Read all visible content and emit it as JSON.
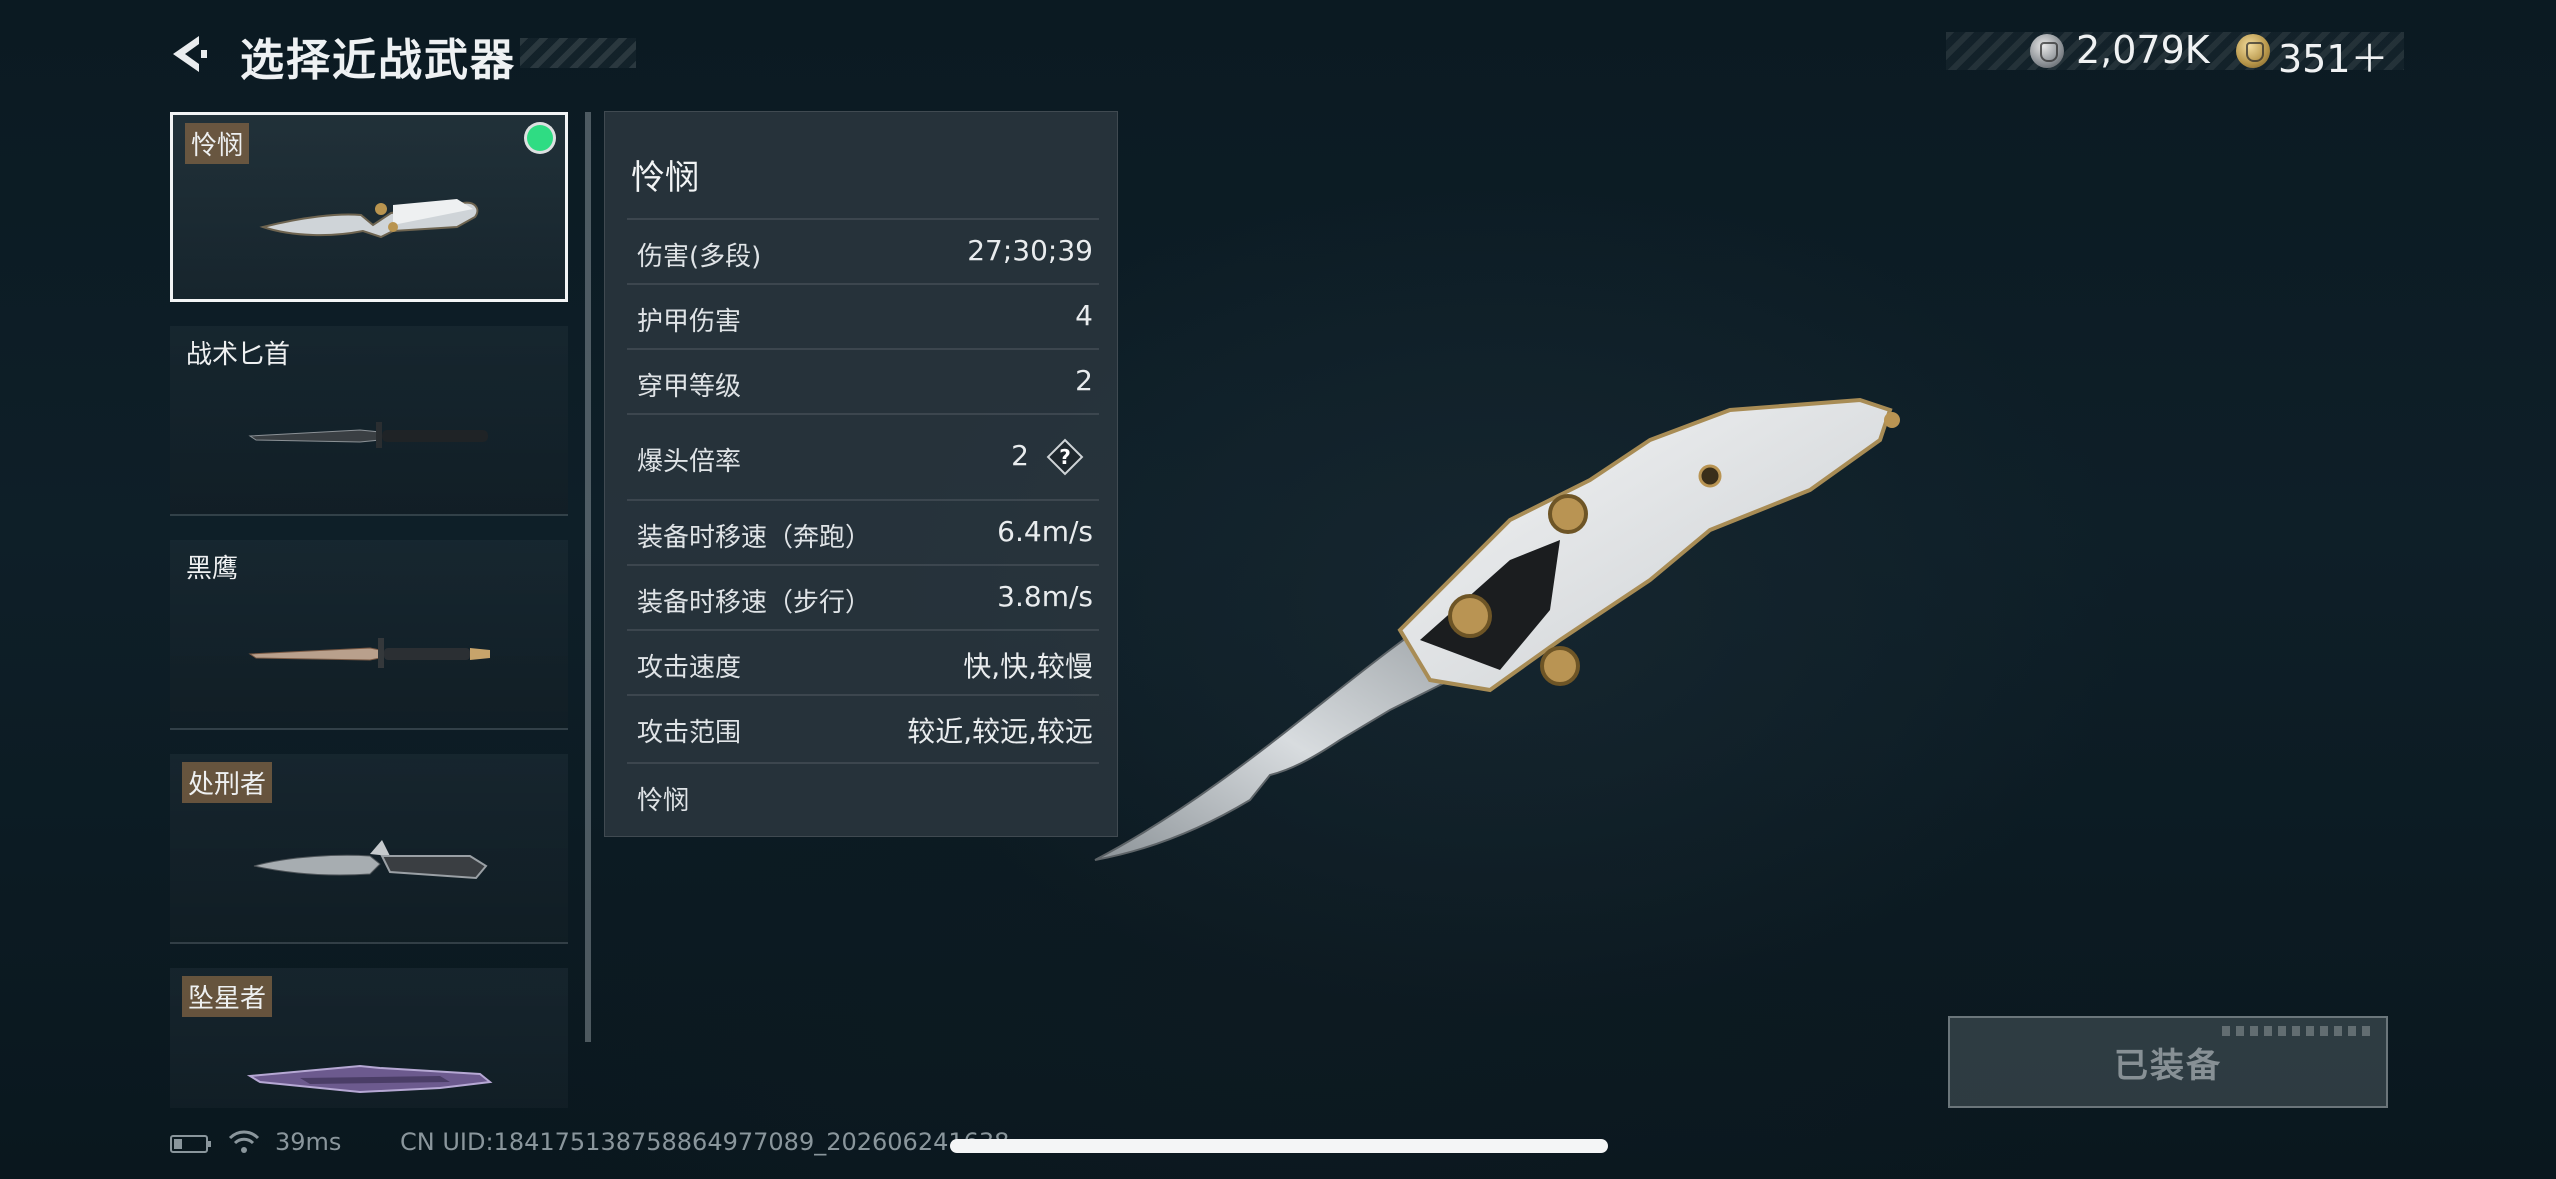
{
  "header": {
    "title": "选择近战武器",
    "currency": [
      {
        "icon": "silver-coin-icon",
        "value": "2,079K"
      },
      {
        "icon": "gold-coin-icon",
        "value": "351＋"
      }
    ]
  },
  "weapons": [
    {
      "name": "怜悯",
      "selected": true,
      "equipped": true
    },
    {
      "name": "战术匕首",
      "selected": false,
      "equipped": false
    },
    {
      "name": "黑鹰",
      "selected": false,
      "equipped": false
    },
    {
      "name": "处刑者",
      "selected": false,
      "equipped": false
    },
    {
      "name": "坠星者",
      "selected": false,
      "equipped": false
    }
  ],
  "details": {
    "name": "怜悯",
    "stats": [
      {
        "label": "伤害(多段)",
        "value": "27;30;39"
      },
      {
        "label": "护甲伤害",
        "value": "4"
      },
      {
        "label": "穿甲等级",
        "value": "2"
      },
      {
        "label": "爆头倍率",
        "value": "2",
        "help": "?"
      },
      {
        "label": "装备时移速（奔跑）",
        "value": "6.4m/s"
      },
      {
        "label": "装备时移速（步行）",
        "value": "3.8m/s"
      },
      {
        "label": "攻击速度",
        "value": "快,快,较慢"
      },
      {
        "label": "攻击范围",
        "value": "较近,较远,较远"
      }
    ],
    "footer": "怜悯"
  },
  "equip_button": {
    "label": "已装备"
  },
  "status": {
    "ping": "39ms",
    "uid": "CN UID:184175138758864977089_202606241638"
  },
  "colors": {
    "equipped_dot": "#2fdc83",
    "name_tag": "#7d6242",
    "background": "#0e1f28"
  }
}
